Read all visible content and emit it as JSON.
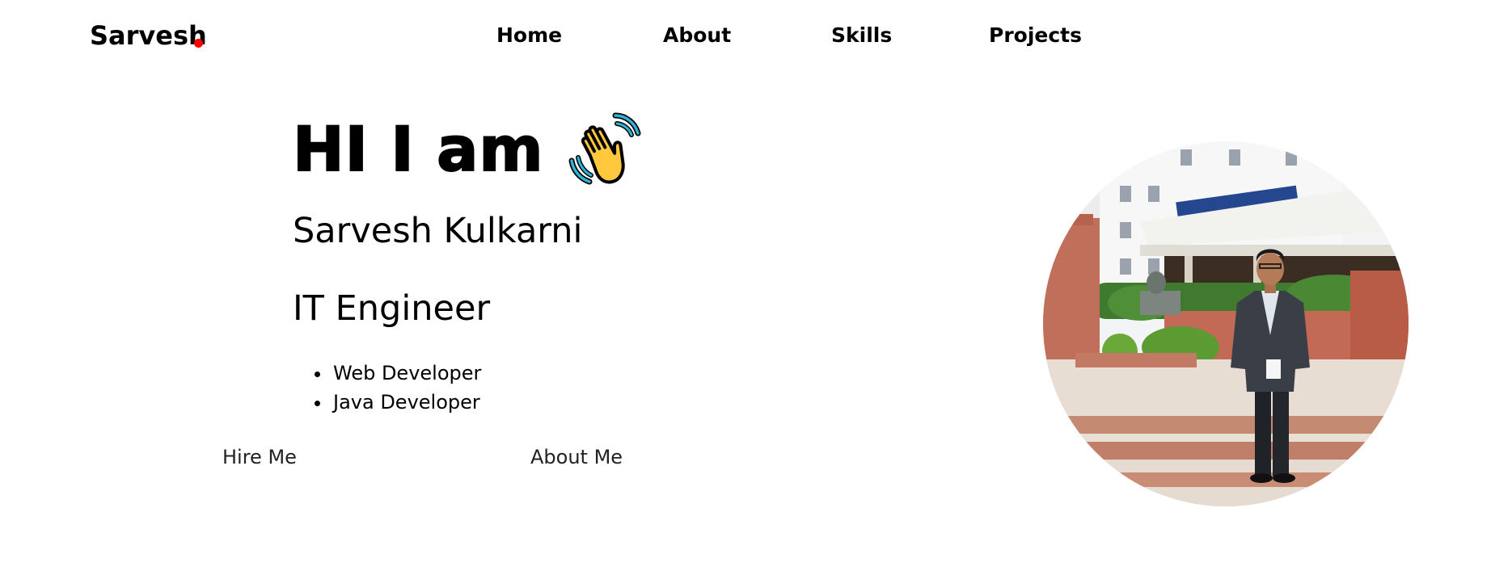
{
  "brand": {
    "name": "Sarvesh",
    "dot_color": "#ff0000"
  },
  "nav": {
    "items": [
      {
        "label": "Home"
      },
      {
        "label": "About"
      },
      {
        "label": "Skills"
      },
      {
        "label": "Projects"
      }
    ]
  },
  "hero": {
    "greeting": "HI I am",
    "greeting_icon": "waving-hand-icon",
    "name": "Sarvesh Kulkarni",
    "role": "IT Engineer",
    "skills": [
      "Web Developer",
      "Java Developer"
    ],
    "buttons": {
      "hire": "Hire Me",
      "about": "About Me"
    },
    "photo": "profile-photo"
  }
}
